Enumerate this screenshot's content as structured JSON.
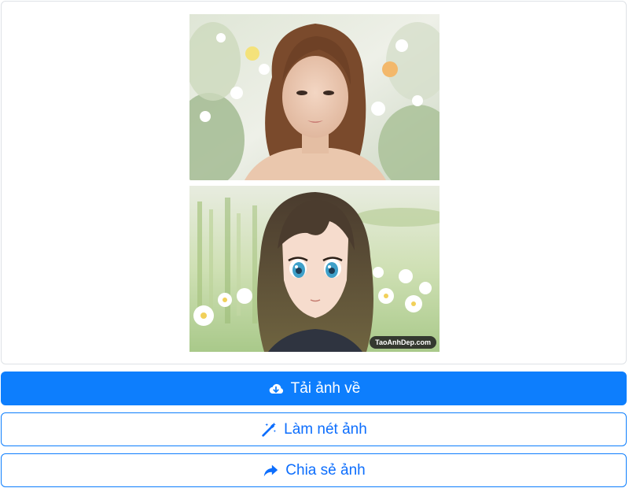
{
  "result": {
    "original_photo_alt": "Ảnh gốc",
    "anime_photo_alt": "Ảnh anime",
    "watermark": "TaoAnhDep.com"
  },
  "actions": {
    "download_label": "Tải ảnh về",
    "enhance_label": "Làm nét ảnh",
    "share_label": "Chia sẻ ảnh"
  },
  "icons": {
    "download": "cloud-download-icon",
    "enhance": "magic-wand-icon",
    "share": "share-arrow-icon"
  },
  "colors": {
    "primary": "#0d7efd",
    "border": "#dee2e6"
  }
}
